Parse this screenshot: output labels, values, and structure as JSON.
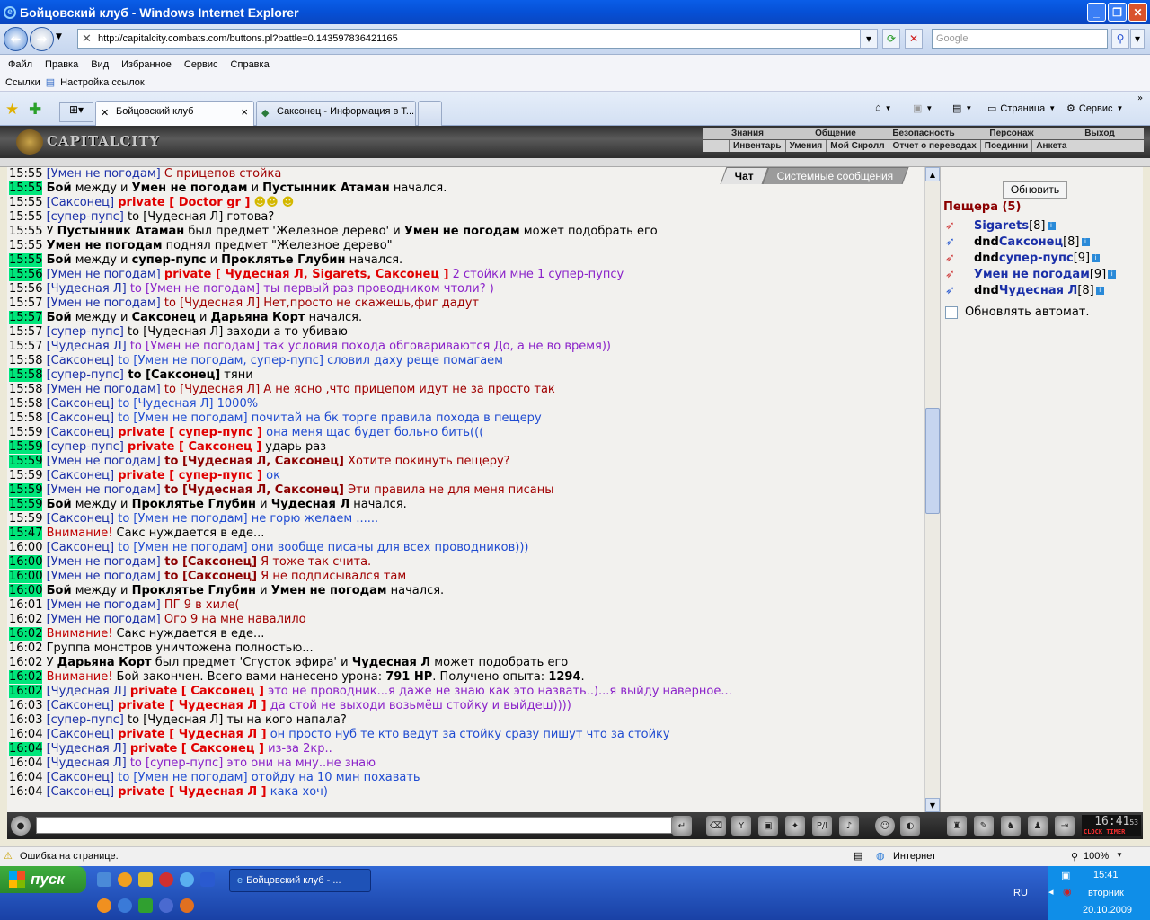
{
  "window": {
    "title": "Бойцовский клуб - Windows Internet Explorer"
  },
  "address": {
    "url": "http://capitalcity.combats.com/buttons.pl?battle=0.143597836421165",
    "search_placeholder": "Google"
  },
  "menu": [
    "Файл",
    "Правка",
    "Вид",
    "Избранное",
    "Сервис",
    "Справка"
  ],
  "links": {
    "label": "Ссылки",
    "item": "Настройка ссылок"
  },
  "tabs": [
    {
      "label": "Бойцовский клуб",
      "close": "×"
    },
    {
      "label": "Саксонец - Информация в Т..."
    }
  ],
  "commandbar": {
    "page": "Страница",
    "service": "Сервис"
  },
  "game": {
    "logo": "CAPITALCITY",
    "topnav": [
      "Знания",
      "Общение",
      "Безопасность",
      "Персонаж",
      "Выход"
    ],
    "subnav": [
      "Инвентарь",
      "Умения",
      "Мой Скролл",
      "Отчет о переводах",
      "Поединки",
      "Анкета"
    ]
  },
  "chat_tabs": [
    "Чат",
    "Системные сообщения"
  ],
  "chat": [
    {
      "time": "15:55",
      "hl": false,
      "parts": [
        [
          "nick",
          "[Умен не погодам]"
        ],
        [
          "red",
          " С прицепов стойка"
        ]
      ]
    },
    {
      "time": "15:55",
      "hl": true,
      "parts": [
        [
          "bold",
          "Бой"
        ],
        [
          "plain",
          " между и "
        ],
        [
          "bold",
          "Умен не погодам"
        ],
        [
          "plain",
          " и "
        ],
        [
          "bold",
          "Пустынник Атаман"
        ],
        [
          "plain",
          " начался."
        ]
      ]
    },
    {
      "time": "15:55",
      "hl": false,
      "parts": [
        [
          "nick",
          "[Саксонец]"
        ],
        [
          "plain",
          " "
        ],
        [
          "priv",
          "private [ Doctor gr ]"
        ],
        [
          "plain",
          " "
        ],
        [
          "smiley",
          "☻☻ ☻"
        ]
      ]
    },
    {
      "time": "15:55",
      "hl": false,
      "parts": [
        [
          "nick",
          "[супер-пупс]"
        ],
        [
          "plain",
          " to [Чудесная Л] готова?"
        ]
      ]
    },
    {
      "time": "15:55",
      "hl": false,
      "parts": [
        [
          "plain",
          "У "
        ],
        [
          "bold",
          "Пустынник Атаман"
        ],
        [
          "plain",
          " был предмет 'Железное дерево' и "
        ],
        [
          "bold",
          "Умен не погодам"
        ],
        [
          "plain",
          " может подобрать его"
        ]
      ]
    },
    {
      "time": "15:55",
      "hl": false,
      "parts": [
        [
          "bold",
          "Умен не погодам"
        ],
        [
          "plain",
          " поднял предмет \"Железное дерево\""
        ]
      ]
    },
    {
      "time": "15:55",
      "hl": true,
      "parts": [
        [
          "bold",
          "Бой"
        ],
        [
          "plain",
          " между и "
        ],
        [
          "bold",
          "супер-пупс"
        ],
        [
          "plain",
          " и "
        ],
        [
          "bold",
          "Проклятье Глубин"
        ],
        [
          "plain",
          " начался."
        ]
      ]
    },
    {
      "time": "15:56",
      "hl": true,
      "parts": [
        [
          "nick",
          "[Умен не погодам]"
        ],
        [
          "plain",
          " "
        ],
        [
          "priv",
          "private [ Чудесная Л, Sigarets, Саксонец ]"
        ],
        [
          "purp",
          " 2 стойки мне 1 супер-пупсу"
        ]
      ]
    },
    {
      "time": "15:56",
      "hl": false,
      "parts": [
        [
          "nick",
          "[Чудесная Л]"
        ],
        [
          "purp",
          " to [Умен не погодам] ты первый раз проводником чтоли? )"
        ]
      ]
    },
    {
      "time": "15:57",
      "hl": false,
      "parts": [
        [
          "nick",
          "[Умен не погодам]"
        ],
        [
          "red",
          " to [Чудесная Л] Нет,просто не скажешь,фиг дадут"
        ]
      ]
    },
    {
      "time": "15:57",
      "hl": true,
      "parts": [
        [
          "bold",
          "Бой"
        ],
        [
          "plain",
          " между и "
        ],
        [
          "bold",
          "Саксонец"
        ],
        [
          "plain",
          " и "
        ],
        [
          "bold",
          "Дарьяна Корт"
        ],
        [
          "plain",
          " начался."
        ]
      ]
    },
    {
      "time": "15:57",
      "hl": false,
      "parts": [
        [
          "nick",
          "[супер-пупс]"
        ],
        [
          "plain",
          " to [Чудесная Л] заходи а то убиваю"
        ]
      ]
    },
    {
      "time": "15:57",
      "hl": false,
      "parts": [
        [
          "nick",
          "[Чудесная Л]"
        ],
        [
          "purp",
          " to [Умен не погодам] так условия похода обговариваются До, а не во время))"
        ]
      ]
    },
    {
      "time": "15:58",
      "hl": false,
      "parts": [
        [
          "nick",
          "[Саксонец]"
        ],
        [
          "blue",
          " to [Умен не погодам, супер-пупс] словил даху реще помагаем"
        ]
      ]
    },
    {
      "time": "15:58",
      "hl": true,
      "parts": [
        [
          "nick",
          "[супер-пупс]"
        ],
        [
          "bold",
          " to [Саксонец]"
        ],
        [
          "plain",
          " тяни"
        ]
      ]
    },
    {
      "time": "15:58",
      "hl": false,
      "parts": [
        [
          "nick",
          "[Умен не погодам]"
        ],
        [
          "red",
          " to [Чудесная Л] А не ясно ,что прицепом идут не за просто так"
        ]
      ]
    },
    {
      "time": "15:58",
      "hl": false,
      "parts": [
        [
          "nick",
          "[Саксонец]"
        ],
        [
          "blue",
          " to [Чудесная Л] 1000%"
        ]
      ]
    },
    {
      "time": "15:58",
      "hl": false,
      "parts": [
        [
          "nick",
          "[Саксонец]"
        ],
        [
          "blue",
          " to [Умен не погодам] почитай на бк торге правила похода в пещеру"
        ]
      ]
    },
    {
      "time": "15:59",
      "hl": false,
      "parts": [
        [
          "nick",
          "[Саксонец]"
        ],
        [
          "plain",
          " "
        ],
        [
          "priv",
          "private [ супер-пупс ]"
        ],
        [
          "blue",
          " она меня щас будет больно бить((("
        ]
      ]
    },
    {
      "time": "15:59",
      "hl": true,
      "parts": [
        [
          "nick",
          "[супер-пупс]"
        ],
        [
          "plain",
          " "
        ],
        [
          "priv",
          "private [ Саксонец ]"
        ],
        [
          "plain",
          " ударь раз"
        ]
      ]
    },
    {
      "time": "15:59",
      "hl": true,
      "parts": [
        [
          "nick",
          "[Умен не погодам]"
        ],
        [
          "tobold",
          " to [Чудесная Л, Саксонец]"
        ],
        [
          "red",
          " Хотите покинуть пещеру?"
        ]
      ]
    },
    {
      "time": "15:59",
      "hl": false,
      "parts": [
        [
          "nick",
          "[Саксонец]"
        ],
        [
          "plain",
          " "
        ],
        [
          "priv",
          "private [ супер-пупс ]"
        ],
        [
          "blue",
          " ок"
        ]
      ]
    },
    {
      "time": "15:59",
      "hl": true,
      "parts": [
        [
          "nick",
          "[Умен не погодам]"
        ],
        [
          "tobold",
          " to [Чудесная Л, Саксонец]"
        ],
        [
          "red",
          " Эти правила не для меня писаны"
        ]
      ]
    },
    {
      "time": "15:59",
      "hl": true,
      "parts": [
        [
          "bold",
          "Бой"
        ],
        [
          "plain",
          " между и "
        ],
        [
          "bold",
          "Проклятье Глубин"
        ],
        [
          "plain",
          " и "
        ],
        [
          "bold",
          "Чудесная Л"
        ],
        [
          "plain",
          " начался."
        ]
      ]
    },
    {
      "time": "15:59",
      "hl": false,
      "parts": [
        [
          "nick",
          "[Саксонец]"
        ],
        [
          "blue",
          " to [Умен не погодам] не горю желаем ......"
        ]
      ]
    },
    {
      "time": "15:47",
      "hl": true,
      "parts": [
        [
          "warn",
          "Внимание!"
        ],
        [
          "plain",
          " Сакс нуждается в еде..."
        ]
      ]
    },
    {
      "time": "16:00",
      "hl": false,
      "parts": [
        [
          "nick",
          "[Саксонец]"
        ],
        [
          "blue",
          " to [Умен не погодам] они вообще писаны для всех проводников)))"
        ]
      ]
    },
    {
      "time": "16:00",
      "hl": true,
      "parts": [
        [
          "nick",
          "[Умен не погодам]"
        ],
        [
          "tobold",
          " to [Саксонец]"
        ],
        [
          "red",
          " Я тоже так считa."
        ]
      ]
    },
    {
      "time": "16:00",
      "hl": true,
      "parts": [
        [
          "nick",
          "[Умен не погодам]"
        ],
        [
          "tobold",
          " to [Саксонец]"
        ],
        [
          "red",
          " Я не подписывался там"
        ]
      ]
    },
    {
      "time": "16:00",
      "hl": true,
      "parts": [
        [
          "bold",
          "Бой"
        ],
        [
          "plain",
          " между и "
        ],
        [
          "bold",
          "Проклятье Глубин"
        ],
        [
          "plain",
          " и "
        ],
        [
          "bold",
          "Умен не погодам"
        ],
        [
          "plain",
          " начался."
        ]
      ]
    },
    {
      "time": "16:01",
      "hl": false,
      "parts": [
        [
          "nick",
          "[Умен не погодам]"
        ],
        [
          "red",
          " ПГ 9 в хиле("
        ]
      ]
    },
    {
      "time": "16:02",
      "hl": false,
      "parts": [
        [
          "nick",
          "[Умен не погодам]"
        ],
        [
          "red",
          " Ого 9 на мне навалило"
        ]
      ]
    },
    {
      "time": "16:02",
      "hl": true,
      "parts": [
        [
          "warn",
          "Внимание!"
        ],
        [
          "plain",
          " Сакс нуждается в еде..."
        ]
      ]
    },
    {
      "time": "16:02",
      "hl": false,
      "parts": [
        [
          "plain",
          "Группа монстров уничтожена полностью..."
        ]
      ]
    },
    {
      "time": "16:02",
      "hl": false,
      "parts": [
        [
          "plain",
          "У "
        ],
        [
          "bold",
          "Дарьяна Корт"
        ],
        [
          "plain",
          " был предмет 'Сгусток эфира' и "
        ],
        [
          "bold",
          "Чудесная Л"
        ],
        [
          "plain",
          " может подобрать его"
        ]
      ]
    },
    {
      "time": "16:02",
      "hl": true,
      "parts": [
        [
          "warn",
          "Внимание!"
        ],
        [
          "plain",
          " Бой закончен. Всего вами нанесено урона: "
        ],
        [
          "bold",
          "791 HP"
        ],
        [
          "plain",
          ". Получено опыта: "
        ],
        [
          "bold",
          "1294"
        ],
        [
          "plain",
          "."
        ]
      ]
    },
    {
      "time": "16:02",
      "hl": true,
      "parts": [
        [
          "nick",
          "[Чудесная Л]"
        ],
        [
          "plain",
          " "
        ],
        [
          "priv",
          "private [ Саксонец ]"
        ],
        [
          "purp",
          " это не проводник...я даже не знаю как это назвать..)...я выйду наверное..."
        ]
      ]
    },
    {
      "time": "16:03",
      "hl": false,
      "parts": [
        [
          "nick",
          "[Саксонец]"
        ],
        [
          "plain",
          " "
        ],
        [
          "priv",
          "private [ Чудесная Л ]"
        ],
        [
          "purp",
          " да стой не выходи возьмёш стойку и выйдеш))))"
        ]
      ]
    },
    {
      "time": "16:03",
      "hl": false,
      "parts": [
        [
          "nick",
          "[супер-пупс]"
        ],
        [
          "plain",
          " to [Чудесная Л] ты на кого напала?"
        ]
      ]
    },
    {
      "time": "16:04",
      "hl": false,
      "parts": [
        [
          "nick",
          "[Саксонец]"
        ],
        [
          "plain",
          " "
        ],
        [
          "priv",
          "private [ Чудесная Л ]"
        ],
        [
          "blue",
          " он просто нуб те кто ведут за стойку сразу пишут что за стойку"
        ]
      ]
    },
    {
      "time": "16:04",
      "hl": true,
      "parts": [
        [
          "nick",
          "[Чудесная Л]"
        ],
        [
          "plain",
          " "
        ],
        [
          "priv",
          "private [ Саксонец ]"
        ],
        [
          "purp",
          " из-за 2кр.."
        ]
      ]
    },
    {
      "time": "16:04",
      "hl": false,
      "parts": [
        [
          "nick",
          "[Чудесная Л]"
        ],
        [
          "purp",
          " to [супер-пупс] это они на мну..не знаю"
        ]
      ]
    },
    {
      "time": "16:04",
      "hl": false,
      "parts": [
        [
          "nick",
          "[Саксонец]"
        ],
        [
          "blue",
          " to [Умен не погодам] отойду на 10 мин похавать"
        ]
      ]
    },
    {
      "time": "16:04",
      "hl": false,
      "parts": [
        [
          "nick",
          "[Саксонец]"
        ],
        [
          "plain",
          " "
        ],
        [
          "priv",
          "private [ Чудесная Л ]"
        ],
        [
          "blue",
          " кака хоч)"
        ]
      ]
    }
  ],
  "right": {
    "refresh": "Обновить",
    "cave_title": "Пещера (5)",
    "users": [
      {
        "prefix": "",
        "name": "Sigarets",
        "level": "[8]"
      },
      {
        "prefix": "dnd ",
        "name": "Саксонец",
        "level": "[8]"
      },
      {
        "prefix": "dnd ",
        "name": "супер-пупс",
        "level": "[9]"
      },
      {
        "prefix": "",
        "name": "Умен не погодам",
        "level": "[9]"
      },
      {
        "prefix": "dnd ",
        "name": "Чудесная Л",
        "level": "[8]"
      }
    ],
    "auto_label": "Обновлять автомат."
  },
  "clock": {
    "time": "16:41",
    "seconds": "53",
    "label": "CLOCK TIMER"
  },
  "statusbar": {
    "error": "Ошибка на странице.",
    "zone": "Интернет",
    "zoom": "100%"
  },
  "taskbar": {
    "start": "пуск",
    "task": "Бойцовский клуб - ...",
    "lang": "RU",
    "time": "15:41",
    "day": "вторник",
    "date": "20.10.2009"
  }
}
